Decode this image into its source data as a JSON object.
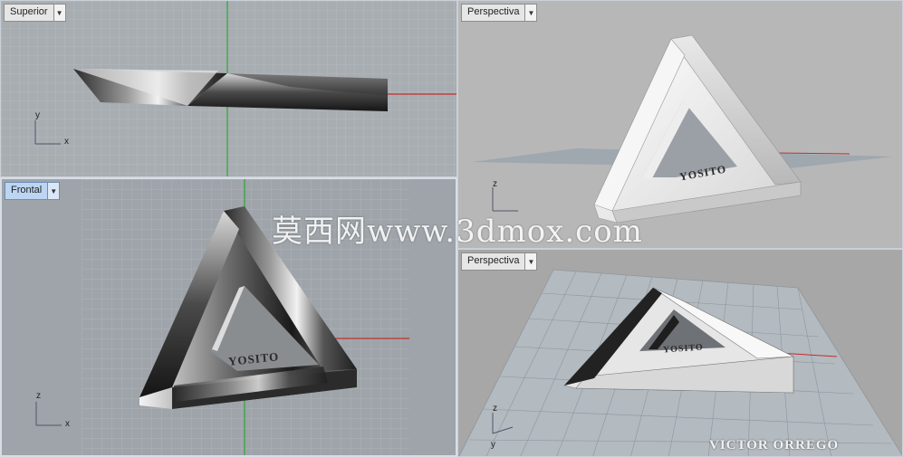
{
  "viewports": {
    "top": {
      "title": "Superior"
    },
    "front": {
      "title": "Frontal"
    },
    "persp1": {
      "title": "Perspectiva"
    },
    "persp2": {
      "title": "Perspectiva"
    }
  },
  "axes": {
    "x": "x",
    "y": "y",
    "z": "z"
  },
  "model": {
    "engraving": "YOSITO"
  },
  "overlay": {
    "watermark": "莫西网www.3dmox.com",
    "signature": "VICTOR  ORREGO"
  },
  "colors": {
    "grid_line": "#b9bec4",
    "x_axis": "#c0302a",
    "y_axis": "#2ea836"
  }
}
